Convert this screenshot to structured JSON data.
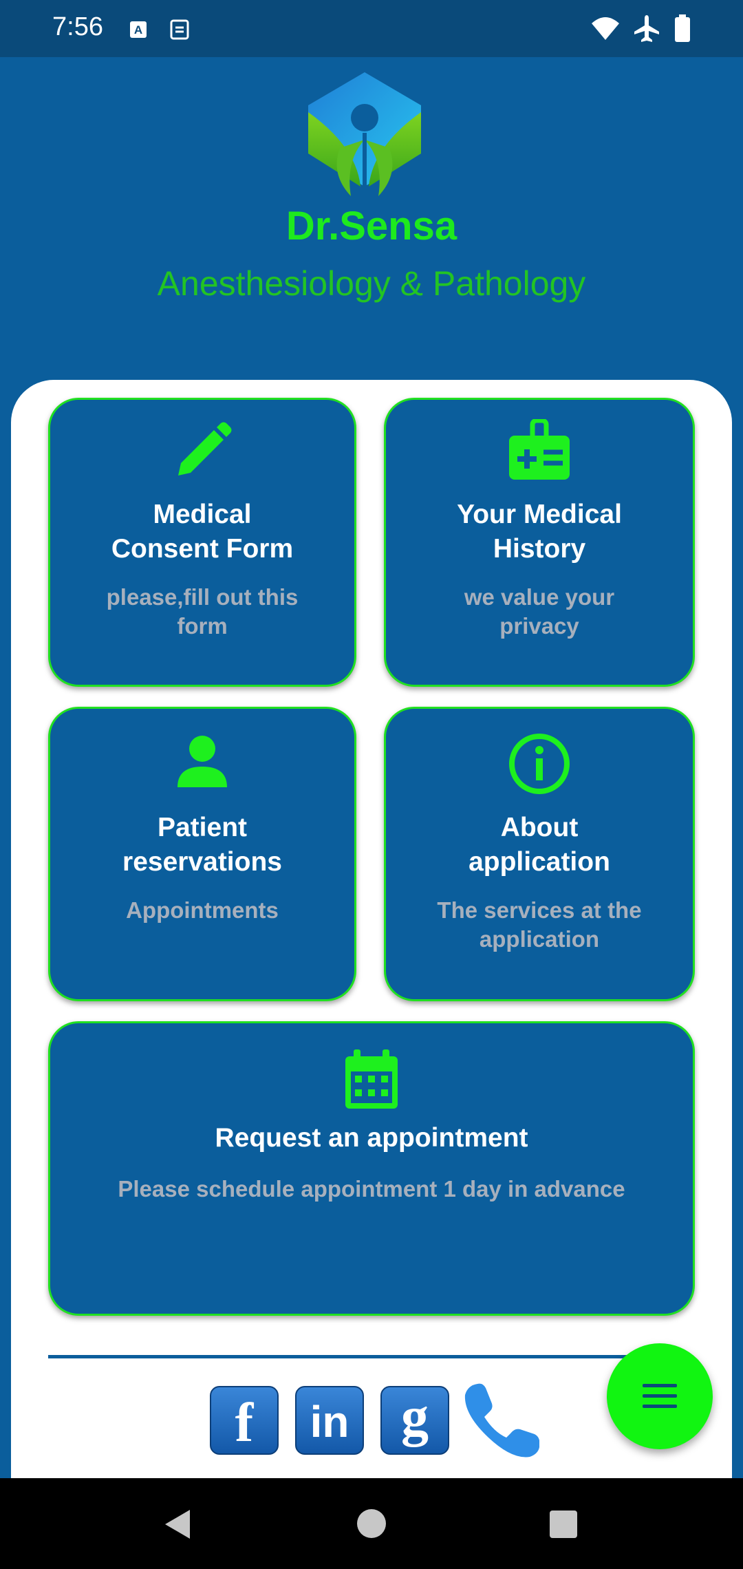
{
  "status_bar": {
    "time": "7:56",
    "left_icons": [
      "a-badge-icon",
      "sim-icon"
    ],
    "right_icons": [
      "wifi-icon",
      "airplane-icon",
      "battery-icon"
    ]
  },
  "header": {
    "logo": "dr-sensa-logo",
    "title": "Dr.Sensa",
    "subtitle": "Anesthesiology  & Pathology"
  },
  "cards": [
    {
      "icon": "pencil-icon",
      "title": "Medical\nConsent Form",
      "subtitle": "please,fill out this\nform"
    },
    {
      "icon": "medical-id-icon",
      "title": "Your Medical\nHistory",
      "subtitle": "we value your\nprivacy"
    },
    {
      "icon": "person-icon",
      "title": "Patient\nreservations",
      "subtitle": "Appointments"
    },
    {
      "icon": "info-icon",
      "title": "About\napplication",
      "subtitle": "The services at the\napplication"
    },
    {
      "icon": "calendar-icon",
      "title": "Request an appointment",
      "subtitle": "Please schedule appointment 1 day in advance"
    }
  ],
  "social": [
    "facebook-icon",
    "linkedin-icon",
    "google-icon",
    "phone-icon"
  ],
  "social_labels": {
    "facebook": "f",
    "linkedin": "in",
    "google": "g"
  },
  "fab": {
    "icon": "menu-icon"
  },
  "nav": [
    "back-icon",
    "home-icon",
    "recents-icon"
  ],
  "colors": {
    "primary_blue": "#0b5e9c",
    "status_blue": "#0a4a7a",
    "accent_green": "#1eea1e",
    "subtitle_green": "#23c423",
    "fab_green": "#11f511",
    "muted_text": "#a7b0bd"
  }
}
